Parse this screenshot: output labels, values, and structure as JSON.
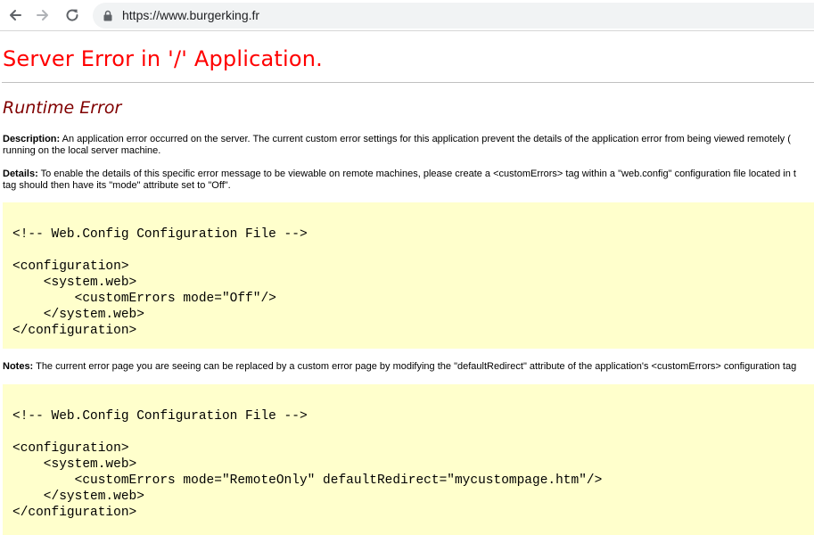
{
  "browser": {
    "url": "https://www.burgerking.fr",
    "back_icon": "arrow-left-icon",
    "forward_icon": "arrow-right-icon",
    "reload_icon": "reload-icon",
    "lock_icon": "lock-icon"
  },
  "page": {
    "title": "Server Error in '/' Application.",
    "subtitle": "Runtime Error",
    "description": {
      "label": "Description:",
      "line1": "An application error occurred on the server. The current custom error settings for this application prevent the details of the application error from being viewed remotely (",
      "line2": "running on the local server machine."
    },
    "details": {
      "label": "Details:",
      "line1": "To enable the details of this specific error message to be viewable on remote machines, please create a <customErrors> tag within a \"web.config\" configuration file located in t",
      "line2": "tag should then have its \"mode\" attribute set to \"Off\"."
    },
    "code1": [
      "<!-- Web.Config Configuration File -->",
      "",
      "<configuration>",
      "    <system.web>",
      "        <customErrors mode=\"Off\"/>",
      "    </system.web>",
      "</configuration>"
    ],
    "notes": {
      "label": "Notes:",
      "line1": "The current error page you are seeing can be replaced by a custom error page by modifying the \"defaultRedirect\" attribute of the application's <customErrors> configuration tag"
    },
    "code2": [
      "<!-- Web.Config Configuration File -->",
      "",
      "<configuration>",
      "    <system.web>",
      "        <customErrors mode=\"RemoteOnly\" defaultRedirect=\"mycustompage.htm\"/>",
      "    </system.web>",
      "</configuration>"
    ]
  },
  "colors": {
    "title": "#ff0000",
    "subtitle": "#800000",
    "code_background": "#ffffcc"
  }
}
